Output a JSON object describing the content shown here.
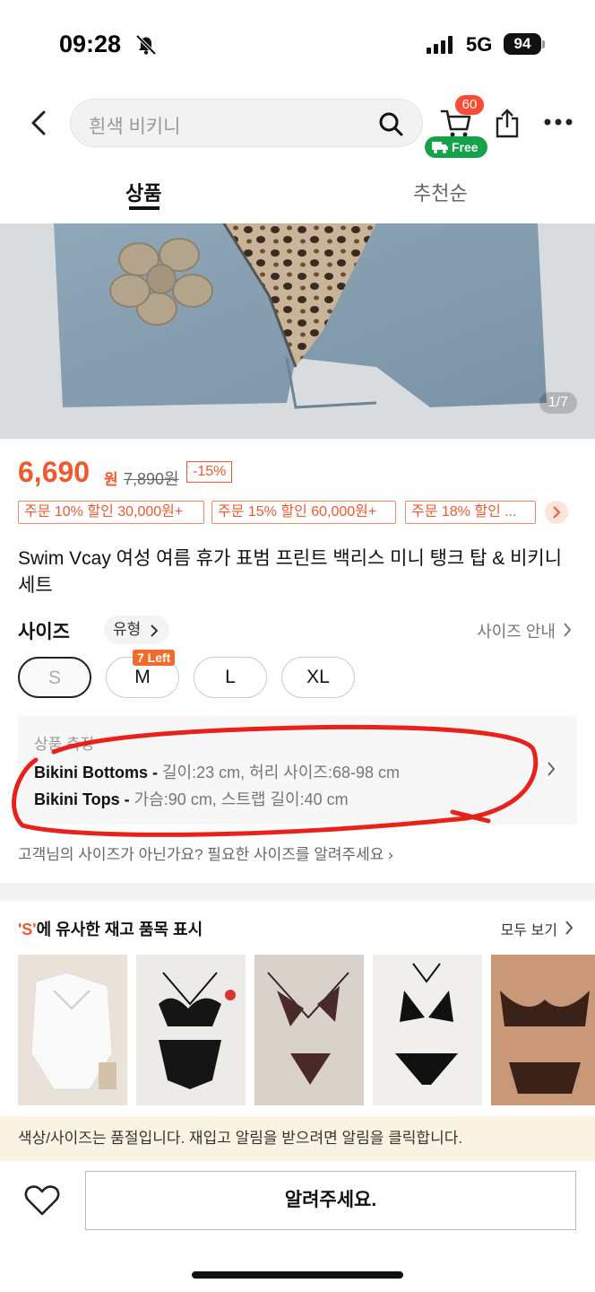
{
  "status": {
    "time": "09:28",
    "network": "5G",
    "battery": "94"
  },
  "header": {
    "search_placeholder": "흰색 비키니",
    "cart_count": "60",
    "free_label": "Free"
  },
  "tabs": [
    {
      "label": "상품",
      "active": true
    },
    {
      "label": "추천순",
      "active": false
    }
  ],
  "gallery": {
    "counter": "1/7"
  },
  "price": {
    "current": "6,690",
    "unit": "원",
    "original": "7,890원",
    "discount": "-15%"
  },
  "coupons": [
    "주문 10% 할인 30,000원+",
    "주문 15% 할인 60,000원+",
    "주문 18% 할인 ..."
  ],
  "product_title": "Swim Vcay 여성 여름 휴가 표범 프린트 백리스 미니 탱크 탑 & 비키니 세트",
  "size_section": {
    "label": "사이즈",
    "type_label": "유형",
    "guide_label": "사이즈 안내",
    "sizes": [
      {
        "label": "S",
        "selected": true,
        "tag": ""
      },
      {
        "label": "M",
        "selected": false,
        "tag": "7 Left"
      },
      {
        "label": "L",
        "selected": false,
        "tag": ""
      },
      {
        "label": "XL",
        "selected": false,
        "tag": ""
      }
    ]
  },
  "measurements": {
    "title": "상품 측정",
    "lines": [
      {
        "name": "Bikini Bottoms -",
        "detail": " 길이:23 cm, 허리 사이즈:68-98 cm"
      },
      {
        "name": "Bikini Tops -",
        "detail": " 가슴:90 cm, 스트랩 길이:40 cm"
      }
    ]
  },
  "not_your_size": "고객님의 사이즈가 아닌가요? 필요한 사이즈를 알려주세요",
  "similar": {
    "highlight": "'S'",
    "title_rest": "에 유사한 재고 품목 표시",
    "view_all": "모두 보기"
  },
  "notice": "색상/사이즈는 품절입니다. 재입고 알림을 받으려면 알림을 클릭합니다.",
  "bottom": {
    "notify_label": "알려주세요."
  },
  "colors": {
    "accent": "#f0582e",
    "free_green": "#15a34a",
    "badge_red": "#fa4b37",
    "annotation_red": "#e8221b"
  }
}
